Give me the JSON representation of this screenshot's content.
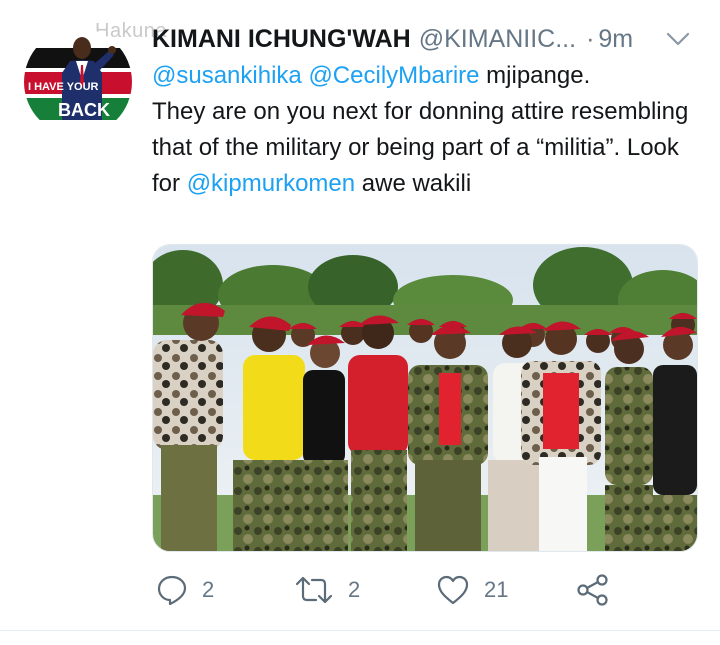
{
  "watermark": "Hakuna",
  "avatar": {
    "banner_text_1": "I HAVE YOUR",
    "banner_text_2": "BACK",
    "colors": {
      "red": "#c8102e",
      "green": "#16803a",
      "black": "#111111",
      "blue": "#1f2f6b"
    }
  },
  "tweet": {
    "author_name": "KIMANI ICHUNG'WAH",
    "handle": "@KIMANIIC...",
    "separator": "·",
    "time": "9m",
    "menu_icon": "chevron-down-icon",
    "text": {
      "mention_1": "@susankihika",
      "mention_2": "@CecilyMbarire",
      "part_1": " mjipange.\nThey are on you next for donning attire resembling that of the military or being part of a “militia”. Look for ",
      "mention_3": "@kipmurkomen",
      "part_2": " awe wakili"
    },
    "image_alt_icon": "photo-group-women-red-berets"
  },
  "actions": {
    "reply": {
      "icon": "reply-icon",
      "count": "2"
    },
    "retweet": {
      "icon": "retweet-icon",
      "count": "2"
    },
    "like": {
      "icon": "heart-icon",
      "count": "21"
    },
    "share": {
      "icon": "share-icon"
    }
  },
  "colors": {
    "link": "#1da1f2",
    "secondary": "#657786",
    "icon": "#5b6b78"
  }
}
